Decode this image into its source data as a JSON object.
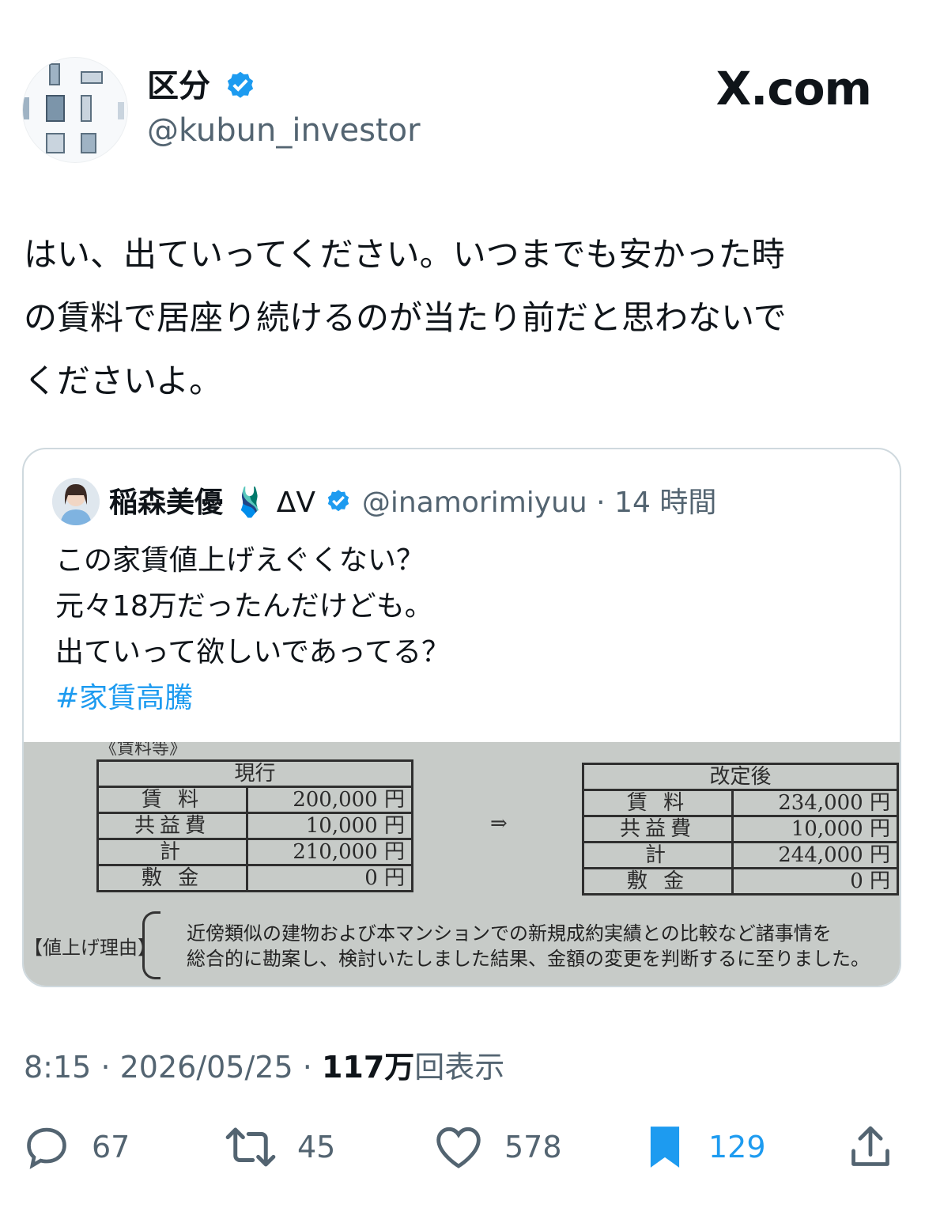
{
  "author": {
    "name": "区分",
    "handle": "@kubun_investor",
    "avatar_icon": "buildings-avatar",
    "verified_icon": "verified-badge-icon"
  },
  "brand": {
    "logo": "X.com"
  },
  "tweet": {
    "text": "はい、出ていってください。いつまでも安かった時\nの賃料で居座り続けるのが当たり前だと思わないで\nくださいよ。"
  },
  "quote": {
    "name": "稲森美優",
    "emoji": "🩱",
    "symbols": "ΔV",
    "handle": "@inamorimiyuu",
    "separator": "·",
    "time": "14 時間",
    "text": "この家賃値上げえぐくない？\n元々18万だったんだけども。\n出ていって欲しいであってる？",
    "hashtag": "#家賃高騰",
    "document": {
      "heading": "《賃料等》",
      "arrow": "⇒",
      "current": {
        "title": "現行",
        "rows": [
          {
            "label": "賃 料",
            "value": "200,000 円"
          },
          {
            "label": "共益費",
            "value": "10,000 円"
          },
          {
            "label": "計",
            "value": "210,000 円"
          },
          {
            "label": "敷 金",
            "value": "0 円"
          }
        ]
      },
      "revised": {
        "title": "改定後",
        "rows": [
          {
            "label": "賃 料",
            "value": "234,000 円"
          },
          {
            "label": "共益費",
            "value": "10,000 円"
          },
          {
            "label": "計",
            "value": "244,000 円"
          },
          {
            "label": "敷 金",
            "value": "0 円"
          }
        ]
      },
      "reason_label": "【値上げ理由】",
      "reason_text": "近傍類似の建物および本マンションでの新規成約実績との比較など諸事情を\n総合的に勘案し、検討いたしました結果、金額の変更を判断するに至りました。"
    }
  },
  "meta": {
    "time": "8:15",
    "sep1": "·",
    "date": "2026/05/25",
    "sep2": "·",
    "views_count": "117万",
    "views_label": "回表示"
  },
  "actions": {
    "reply": {
      "icon": "reply-icon",
      "count": "67"
    },
    "repost": {
      "icon": "repost-icon",
      "count": "45"
    },
    "like": {
      "icon": "heart-icon",
      "count": "578"
    },
    "bookmark": {
      "icon": "bookmark-icon",
      "count": "129",
      "active": true
    },
    "share": {
      "icon": "share-icon"
    }
  },
  "colors": {
    "accent": "#1d9bf0",
    "secondary_text": "#536471",
    "border": "#cfd9de"
  }
}
